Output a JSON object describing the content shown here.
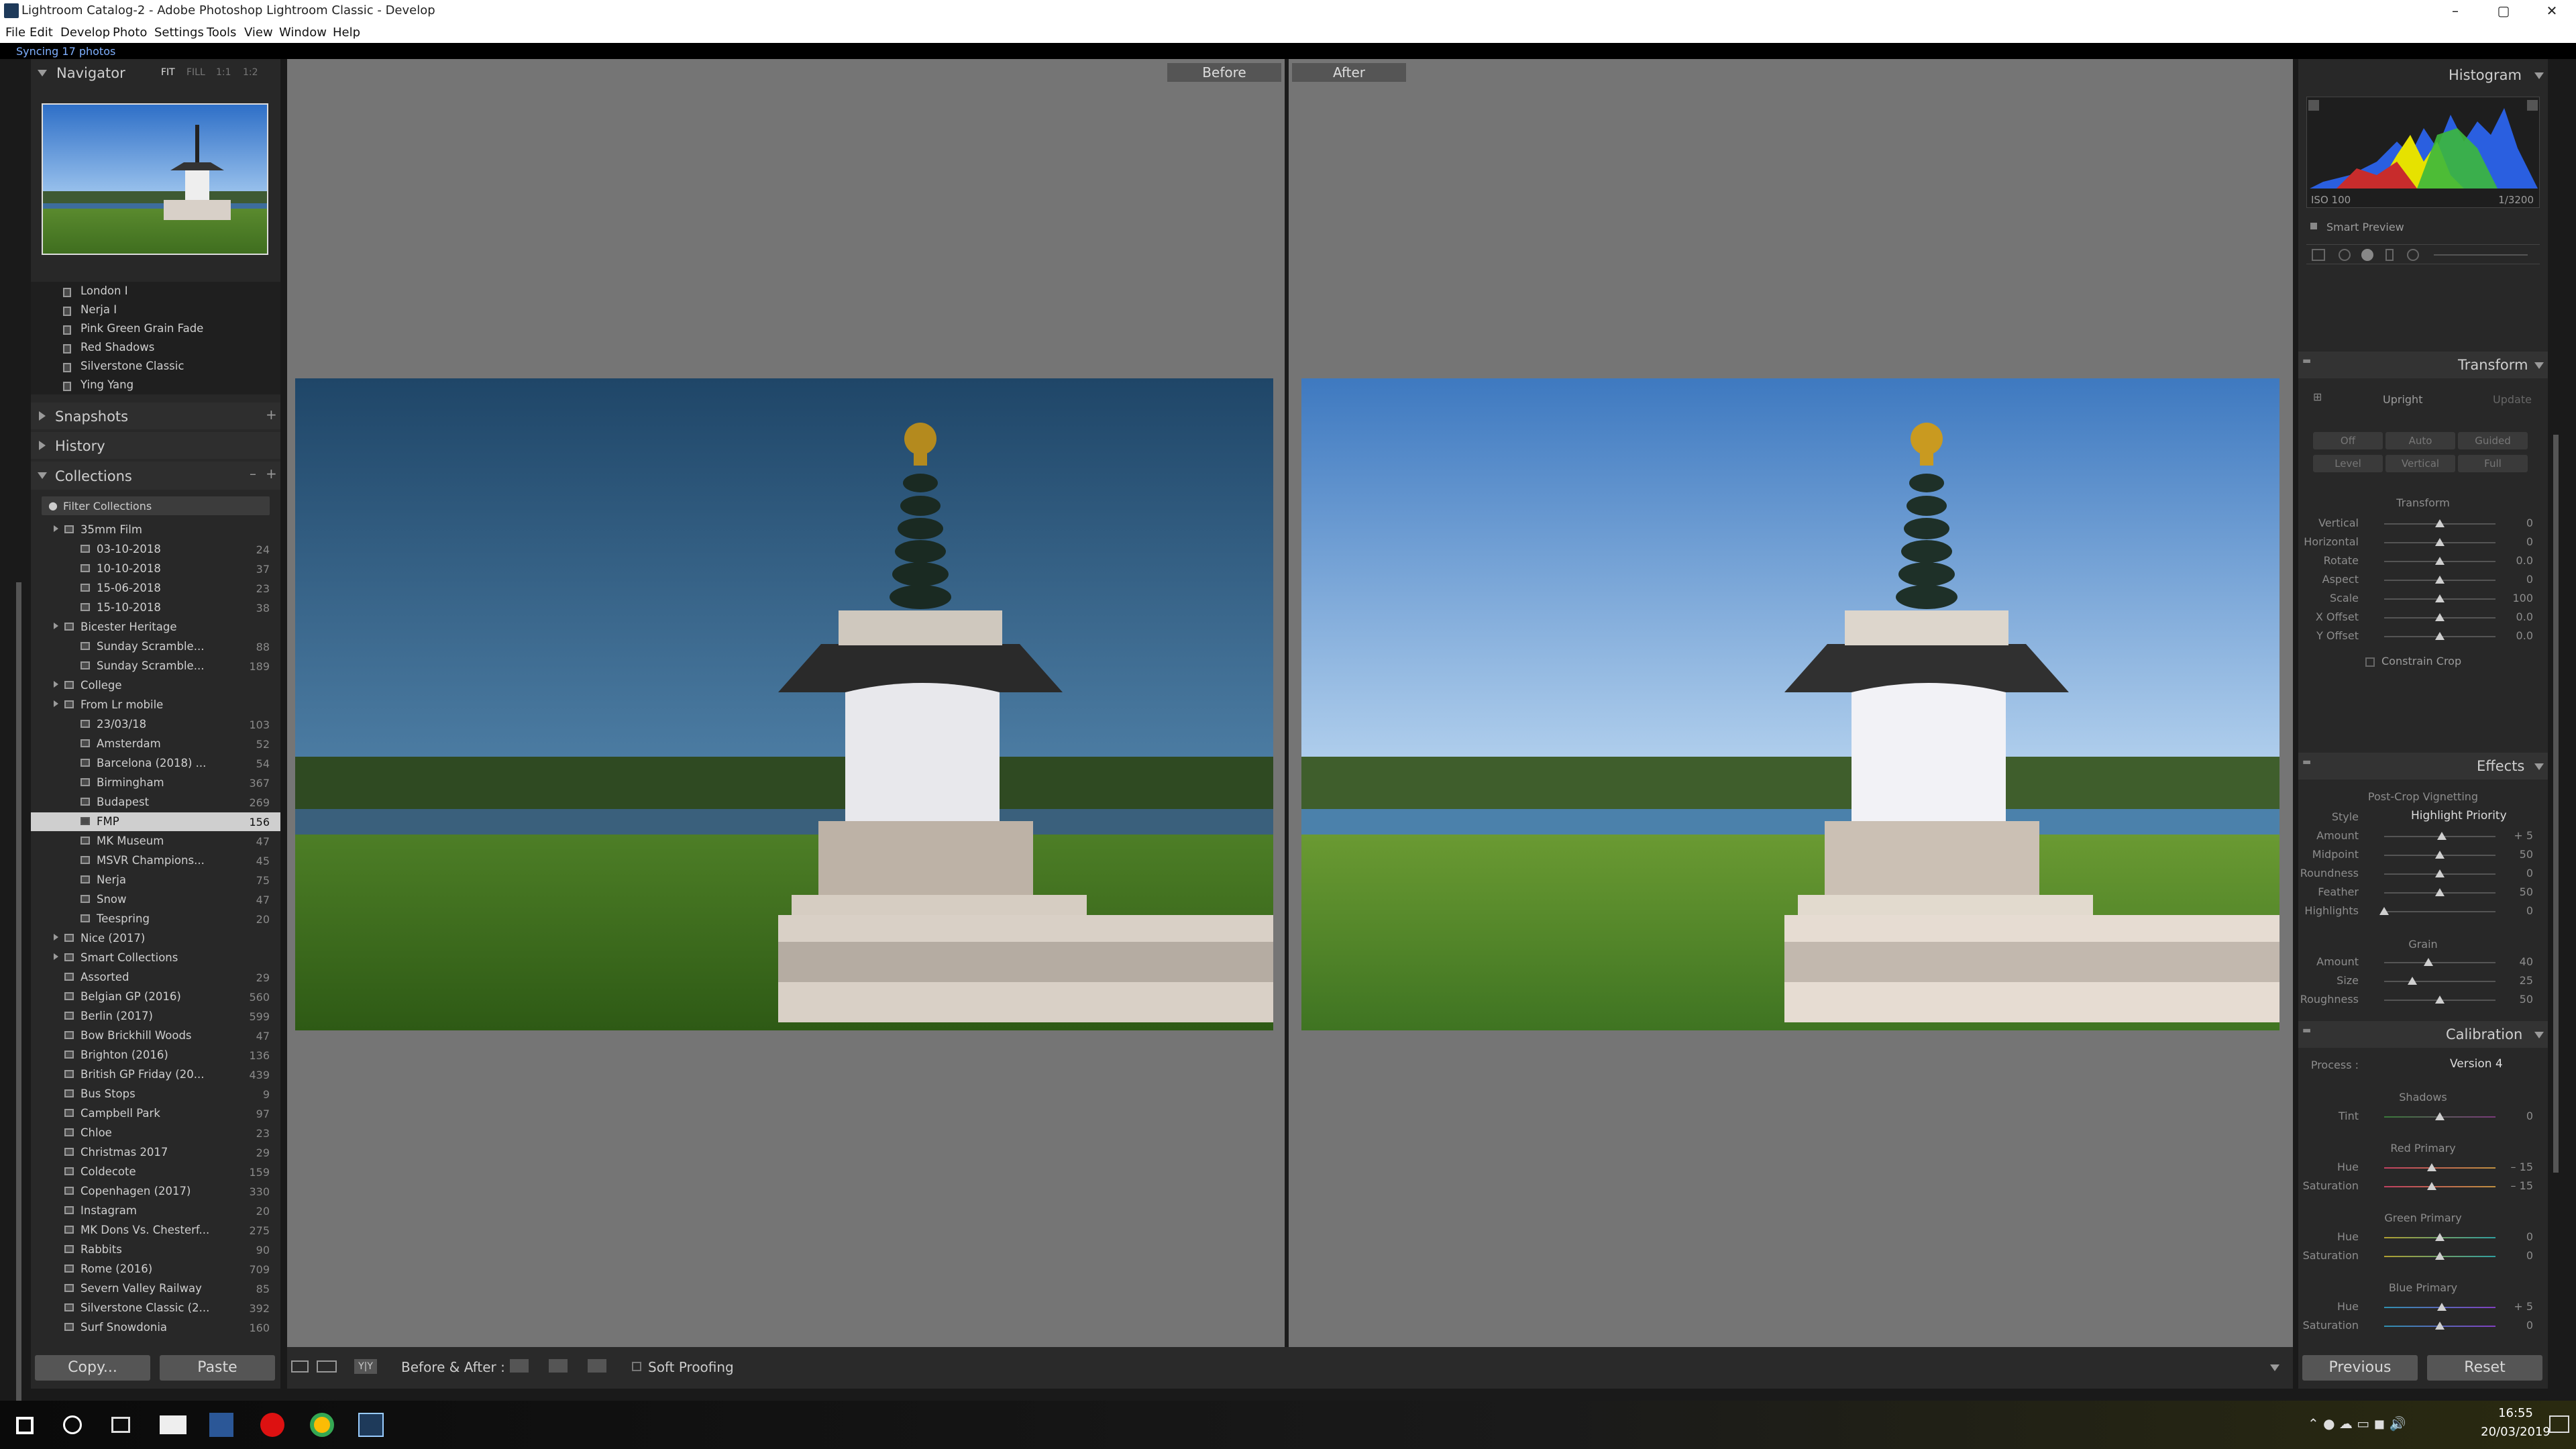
{
  "window": {
    "title": "Lightroom Catalog-2 - Adobe Photoshop Lightroom Classic - Develop",
    "min": "–",
    "max": "▢",
    "close": "✕"
  },
  "menu": [
    "File",
    "Edit",
    "Develop",
    "Photo",
    "Settings",
    "Tools",
    "View",
    "Window",
    "Help"
  ],
  "sync_status": "Syncing 17 photos",
  "navigator": {
    "title": "Navigator",
    "zoom": [
      "FIT",
      "FILL",
      "1:1",
      "1:2"
    ]
  },
  "presets": [
    "London I",
    "Nerja I",
    "Pink Green Grain Fade",
    "Red Shadows",
    "Silverstone Classic",
    "Ying Yang"
  ],
  "snapshots_title": "Snapshots",
  "history_title": "History",
  "collections": {
    "title": "Collections",
    "filter": "Filter Collections",
    "items": [
      {
        "label": "35mm Film",
        "count": "",
        "kind": "set",
        "level": 1
      },
      {
        "label": "03-10-2018",
        "count": "24",
        "kind": "coll",
        "level": 2
      },
      {
        "label": "10-10-2018",
        "count": "37",
        "kind": "coll",
        "level": 2
      },
      {
        "label": "15-06-2018",
        "count": "23",
        "kind": "coll",
        "level": 2
      },
      {
        "label": "15-10-2018",
        "count": "38",
        "kind": "coll",
        "level": 2
      },
      {
        "label": "Bicester Heritage",
        "count": "",
        "kind": "set",
        "level": 1
      },
      {
        "label": "Sunday Scramble...",
        "count": "88",
        "kind": "coll",
        "level": 2
      },
      {
        "label": "Sunday Scramble...",
        "count": "189",
        "kind": "coll",
        "level": 2
      },
      {
        "label": "College",
        "count": "",
        "kind": "set",
        "level": 1
      },
      {
        "label": "From Lr mobile",
        "count": "",
        "kind": "set",
        "level": 1
      },
      {
        "label": "23/03/18",
        "count": "103",
        "kind": "coll",
        "level": 2
      },
      {
        "label": "Amsterdam",
        "count": "52",
        "kind": "coll",
        "level": 2
      },
      {
        "label": "Barcelona (2018) ...",
        "count": "54",
        "kind": "coll",
        "level": 2
      },
      {
        "label": "Birmingham",
        "count": "367",
        "kind": "coll",
        "level": 2
      },
      {
        "label": "Budapest",
        "count": "269",
        "kind": "coll",
        "level": 2
      },
      {
        "label": "FMP",
        "count": "156",
        "kind": "coll",
        "level": 2,
        "selected": true
      },
      {
        "label": "MK Museum",
        "count": "47",
        "kind": "coll",
        "level": 2
      },
      {
        "label": "MSVR Champions...",
        "count": "45",
        "kind": "coll",
        "level": 2
      },
      {
        "label": "Nerja",
        "count": "75",
        "kind": "coll",
        "level": 2
      },
      {
        "label": "Snow",
        "count": "47",
        "kind": "coll",
        "level": 2
      },
      {
        "label": "Teespring",
        "count": "20",
        "kind": "coll",
        "level": 2
      },
      {
        "label": "Nice (2017)",
        "count": "",
        "kind": "set",
        "level": 1
      },
      {
        "label": "Smart Collections",
        "count": "",
        "kind": "set",
        "level": 1
      },
      {
        "label": "Assorted",
        "count": "29",
        "kind": "coll",
        "level": 1
      },
      {
        "label": "Belgian GP (2016)",
        "count": "560",
        "kind": "coll",
        "level": 1
      },
      {
        "label": "Berlin (2017)",
        "count": "599",
        "kind": "coll",
        "level": 1
      },
      {
        "label": "Bow Brickhill Woods",
        "count": "47",
        "kind": "coll",
        "level": 1
      },
      {
        "label": "Brighton (2016)",
        "count": "136",
        "kind": "coll",
        "level": 1
      },
      {
        "label": "British GP Friday (20...",
        "count": "439",
        "kind": "coll",
        "level": 1
      },
      {
        "label": "Bus Stops",
        "count": "9",
        "kind": "coll",
        "level": 1
      },
      {
        "label": "Campbell Park",
        "count": "97",
        "kind": "coll",
        "level": 1
      },
      {
        "label": "Chloe",
        "count": "23",
        "kind": "coll",
        "level": 1
      },
      {
        "label": "Christmas 2017",
        "count": "29",
        "kind": "coll",
        "level": 1
      },
      {
        "label": "Coldecote",
        "count": "159",
        "kind": "coll",
        "level": 1
      },
      {
        "label": "Copenhagen (2017)",
        "count": "330",
        "kind": "coll",
        "level": 1
      },
      {
        "label": "Instagram",
        "count": "20",
        "kind": "coll",
        "level": 1
      },
      {
        "label": "MK Dons Vs. Chesterf...",
        "count": "275",
        "kind": "coll",
        "level": 1
      },
      {
        "label": "Rabbits",
        "count": "90",
        "kind": "coll",
        "level": 1
      },
      {
        "label": "Rome (2016)",
        "count": "709",
        "kind": "coll",
        "level": 1
      },
      {
        "label": "Severn Valley Railway",
        "count": "85",
        "kind": "coll",
        "level": 1
      },
      {
        "label": "Silverstone Classic (2...",
        "count": "392",
        "kind": "coll",
        "level": 1
      },
      {
        "label": "Surf Snowdonia",
        "count": "160",
        "kind": "coll",
        "level": 1
      }
    ]
  },
  "left_buttons": {
    "copy": "Copy...",
    "paste": "Paste"
  },
  "view": {
    "before": "Before",
    "after": "After"
  },
  "toolbar": {
    "before_after": "Before & After :",
    "soft_proofing": "Soft Proofing"
  },
  "histogram": {
    "title": "Histogram",
    "iso": "ISO 100",
    "shutter": "1/3200",
    "smart_preview": "Smart Preview"
  },
  "transform": {
    "title": "Transform",
    "upright": "Upright",
    "update": "Update",
    "buttons": [
      "Off",
      "Auto",
      "Guided",
      "Level",
      "Vertical",
      "Full"
    ],
    "section": "Transform",
    "rows": [
      {
        "label": "Vertical",
        "value": "0",
        "pos": 0.5
      },
      {
        "label": "Horizontal",
        "value": "0",
        "pos": 0.5
      },
      {
        "label": "Rotate",
        "value": "0.0",
        "pos": 0.5
      },
      {
        "label": "Aspect",
        "value": "0",
        "pos": 0.5
      },
      {
        "label": "Scale",
        "value": "100",
        "pos": 0.5
      },
      {
        "label": "X Offset",
        "value": "0.0",
        "pos": 0.5
      },
      {
        "label": "Y Offset",
        "value": "0.0",
        "pos": 0.5
      }
    ],
    "constrain": "Constrain Crop"
  },
  "effects": {
    "title": "Effects",
    "section": "Post-Crop Vignetting",
    "style_label": "Style",
    "style_value": "Highlight Priority",
    "rows": [
      {
        "label": "Amount",
        "value": "+ 5",
        "pos": 0.52
      },
      {
        "label": "Midpoint",
        "value": "50",
        "pos": 0.5
      },
      {
        "label": "Roundness",
        "value": "0",
        "pos": 0.5
      },
      {
        "label": "Feather",
        "value": "50",
        "pos": 0.5
      },
      {
        "label": "Highlights",
        "value": "0",
        "pos": 0.0
      }
    ],
    "grain": "Grain",
    "grain_rows": [
      {
        "label": "Amount",
        "value": "40",
        "pos": 0.4
      },
      {
        "label": "Size",
        "value": "25",
        "pos": 0.25
      },
      {
        "label": "Roughness",
        "value": "50",
        "pos": 0.5
      }
    ]
  },
  "calibration": {
    "title": "Calibration",
    "process_label": "Process :",
    "process_value": "Version 4",
    "groups": [
      {
        "name": "Shadows",
        "rows": [
          {
            "label": "Tint",
            "value": "0",
            "pos": 0.5
          }
        ]
      },
      {
        "name": "Red Primary",
        "rows": [
          {
            "label": "Hue",
            "value": "– 15",
            "pos": 0.43
          },
          {
            "label": "Saturation",
            "value": "– 15",
            "pos": 0.43
          }
        ]
      },
      {
        "name": "Green Primary",
        "rows": [
          {
            "label": "Hue",
            "value": "0",
            "pos": 0.5
          },
          {
            "label": "Saturation",
            "value": "0",
            "pos": 0.5
          }
        ]
      },
      {
        "name": "Blue Primary",
        "rows": [
          {
            "label": "Hue",
            "value": "+ 5",
            "pos": 0.52
          },
          {
            "label": "Saturation",
            "value": "0",
            "pos": 0.5
          }
        ]
      }
    ]
  },
  "right_buttons": {
    "previous": "Previous",
    "reset": "Reset"
  },
  "taskbar": {
    "time": "16:55",
    "date": "20/03/2019"
  }
}
